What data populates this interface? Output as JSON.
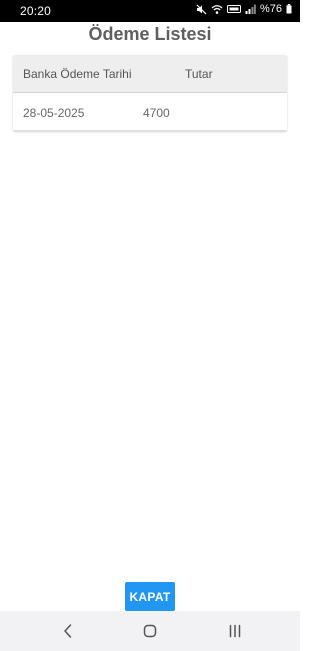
{
  "status_bar": {
    "time": "20:20",
    "battery_percent": "%76",
    "icons": [
      "mute-icon",
      "wifi-icon",
      "volte-icon",
      "signal-icon",
      "battery-icon"
    ]
  },
  "page": {
    "title": "Ödeme Listesi"
  },
  "table": {
    "columns": [
      "Banka Ödeme Tarihi",
      "Tutar"
    ],
    "rows": [
      [
        "28-05-2025",
        "4700"
      ]
    ]
  },
  "close_button": {
    "label": "KAPAT",
    "color": "#2196f3"
  },
  "nav_bar": {
    "icons": [
      "back-icon",
      "home-icon",
      "recents-icon"
    ]
  }
}
